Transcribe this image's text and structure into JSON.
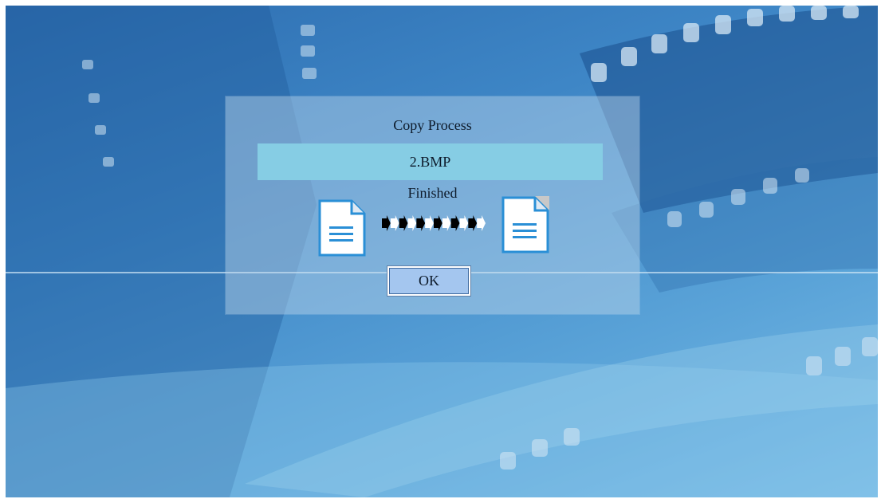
{
  "dialog": {
    "title": "Copy Process",
    "filename": "2.BMP",
    "status": "Finished",
    "ok_label": "OK",
    "icons": {
      "source": "document-icon",
      "progress": "arrow-progress-icon",
      "destination": "document-icon"
    },
    "progress_steps_total": 6,
    "progress_steps_done": 3
  },
  "colors": {
    "filename_bar": "#86cde4",
    "ok_button": "#a4c6ef",
    "icon_blue": "#2a8fd6",
    "text": "#0d1a2a"
  }
}
